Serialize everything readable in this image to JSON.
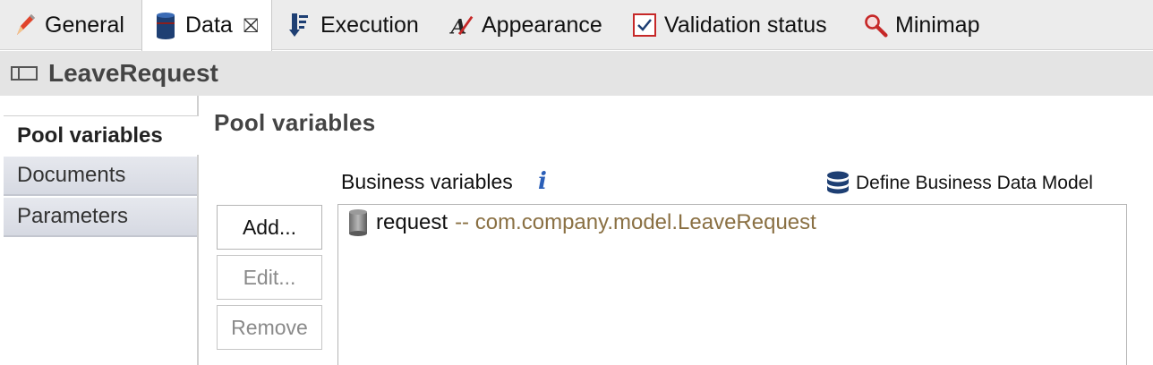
{
  "tabs": [
    {
      "label": "General",
      "icon": "pencil-icon"
    },
    {
      "label": "Data",
      "icon": "data-cylinder-icon",
      "active": true,
      "closable": true
    },
    {
      "label": "Execution",
      "icon": "execution-icon"
    },
    {
      "label": "Appearance",
      "icon": "appearance-icon"
    },
    {
      "label": "Validation status",
      "icon": "checkbox-icon"
    },
    {
      "label": "Minimap",
      "icon": "magnifier-icon"
    }
  ],
  "tab_close_glyph": "⛝",
  "pool": {
    "title": "LeaveRequest",
    "icon": "pool-icon"
  },
  "side_tabs": [
    {
      "label": "Pool variables",
      "active": true
    },
    {
      "label": "Documents"
    },
    {
      "label": "Parameters"
    }
  ],
  "content": {
    "section_title": "Pool variables",
    "business_variables_label": "Business variables",
    "info_glyph": "i",
    "define_link": "Define Business Data Model"
  },
  "buttons": {
    "add": "Add...",
    "edit": "Edit...",
    "remove": "Remove"
  },
  "variables": [
    {
      "name": "request",
      "type": "-- com.company.model.LeaveRequest"
    }
  ],
  "colors": {
    "accent_blue": "#2b5fb8",
    "type_text": "#8a7043",
    "validation_red": "#c62828"
  }
}
